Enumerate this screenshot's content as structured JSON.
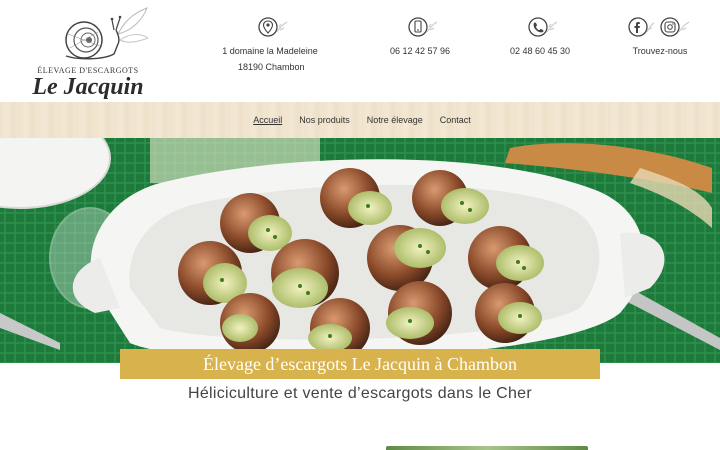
{
  "brand": {
    "subtitle": "ÉLEVAGE D'ESCARGOTS",
    "name": "Le Jacquin"
  },
  "contacts": {
    "address_line1": "1 domaine la Madeleine",
    "address_line2": "18190 Chambon",
    "mobile": "06 12 42 57 96",
    "phone": "02 48 60 45 30",
    "social": "Trouvez-nous"
  },
  "nav": {
    "items": [
      {
        "label": "Accueil",
        "active": true
      },
      {
        "label": "Nos produits",
        "active": false
      },
      {
        "label": "Notre élevage",
        "active": false
      },
      {
        "label": "Contact",
        "active": false
      }
    ]
  },
  "hero": {
    "title": "Élevage d’escargots Le Jacquin à Chambon",
    "subtitle": "Héliciculture et vente d’escargots dans le Cher"
  },
  "colors": {
    "accent": "#d8b24c",
    "nav_bg": "#f0e4cd",
    "tablecloth": "#1f7a3a"
  },
  "icons": {
    "address": "map-pin-icon",
    "mobile": "mobile-phone-icon",
    "phone": "phone-icon",
    "facebook": "facebook-icon",
    "instagram": "instagram-icon"
  }
}
